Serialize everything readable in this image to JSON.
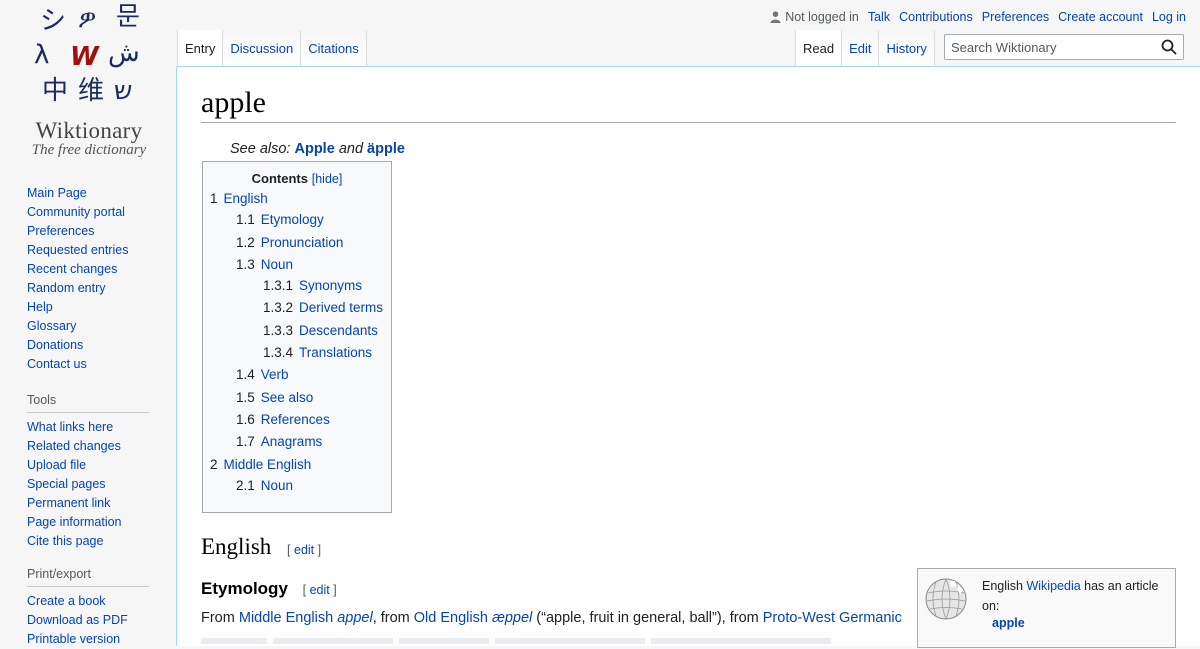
{
  "logo": {
    "glyphs": [
      "シ",
      "ዎ",
      "문",
      "λ",
      "W",
      "ش",
      "中",
      "维",
      "ש"
    ],
    "title": "Wiktionary",
    "tagline": "The free dictionary"
  },
  "sidebar": {
    "main": [
      {
        "label": "Main Page"
      },
      {
        "label": "Community portal"
      },
      {
        "label": "Preferences"
      },
      {
        "label": "Requested entries"
      },
      {
        "label": "Recent changes"
      },
      {
        "label": "Random entry"
      },
      {
        "label": "Help"
      },
      {
        "label": "Glossary"
      },
      {
        "label": "Donations"
      },
      {
        "label": "Contact us"
      }
    ],
    "tools_heading": "Tools",
    "tools": [
      {
        "label": "What links here"
      },
      {
        "label": "Related changes"
      },
      {
        "label": "Upload file"
      },
      {
        "label": "Special pages"
      },
      {
        "label": "Permanent link"
      },
      {
        "label": "Page information"
      },
      {
        "label": "Cite this page"
      }
    ],
    "print_heading": "Print/export",
    "print": [
      {
        "label": "Create a book"
      },
      {
        "label": "Download as PDF"
      },
      {
        "label": "Printable version"
      }
    ]
  },
  "personal": {
    "status": "Not logged in",
    "links": [
      "Talk",
      "Contributions",
      "Preferences",
      "Create account",
      "Log in"
    ]
  },
  "tabs": {
    "left": [
      "Entry",
      "Discussion",
      "Citations"
    ],
    "right": [
      "Read",
      "Edit",
      "History"
    ]
  },
  "search": {
    "placeholder": "Search Wiktionary"
  },
  "page": {
    "title": "apple",
    "see_also_prefix": "See also:",
    "see_also_links": [
      "Apple",
      "äpple"
    ],
    "see_also_and": "and"
  },
  "toc": {
    "title": "Contents",
    "hide": "[hide]",
    "items": [
      {
        "num": "1",
        "label": "English",
        "level": 1
      },
      {
        "num": "1.1",
        "label": "Etymology",
        "level": 2
      },
      {
        "num": "1.2",
        "label": "Pronunciation",
        "level": 2
      },
      {
        "num": "1.3",
        "label": "Noun",
        "level": 2
      },
      {
        "num": "1.3.1",
        "label": "Synonyms",
        "level": 3
      },
      {
        "num": "1.3.2",
        "label": "Derived terms",
        "level": 3
      },
      {
        "num": "1.3.3",
        "label": "Descendants",
        "level": 3
      },
      {
        "num": "1.3.4",
        "label": "Translations",
        "level": 3
      },
      {
        "num": "1.4",
        "label": "Verb",
        "level": 2
      },
      {
        "num": "1.5",
        "label": "See also",
        "level": 2
      },
      {
        "num": "1.6",
        "label": "References",
        "level": 2
      },
      {
        "num": "1.7",
        "label": "Anagrams",
        "level": 2
      },
      {
        "num": "2",
        "label": "Middle English",
        "level": 1
      },
      {
        "num": "2.1",
        "label": "Noun",
        "level": 2
      }
    ]
  },
  "sections": {
    "english": "English",
    "etymology": "Etymology",
    "edit_open": "[",
    "edit_label": "edit",
    "edit_close": "]"
  },
  "etymology": {
    "from1": "From ",
    "link1": "Middle English",
    "space1": " ",
    "term1": "appel",
    "from2": ", from ",
    "link2": "Old English",
    "space2": " ",
    "term2": "æppel",
    "gloss": " (“apple, fruit in general, ball”), from ",
    "link3": "Proto-West Germanic"
  },
  "wikipedia_box": {
    "text_before": "English ",
    "link": "Wikipedia",
    "text_after": " has an article on:",
    "article": "apple"
  },
  "colors": {
    "link": "#0645ad",
    "border": "#a7d7f9",
    "toc_bg": "#f8f9fa"
  }
}
